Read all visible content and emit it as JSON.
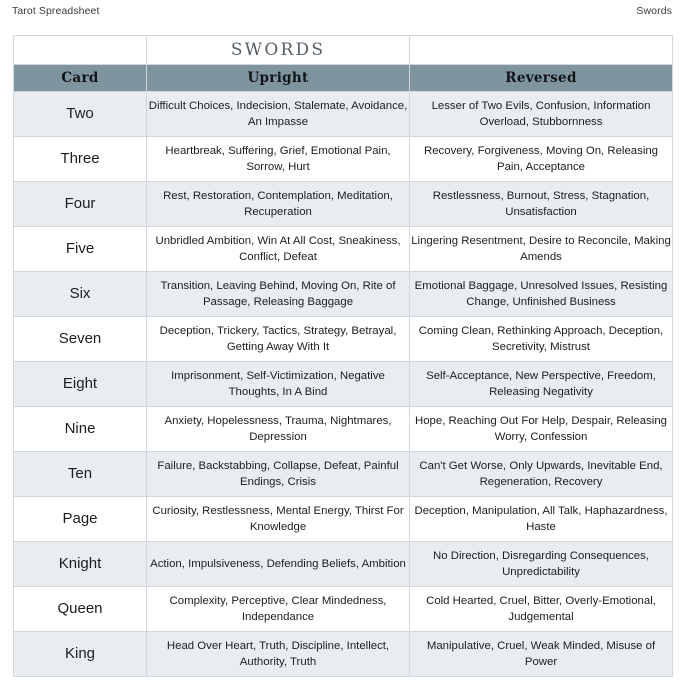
{
  "doc_header": {
    "left": "Tarot Spreadsheet",
    "right": "Swords"
  },
  "table": {
    "suit_title": "SWORDS",
    "columns": {
      "card": "Card",
      "upright": "Upright",
      "reversed": "Reversed"
    },
    "colors": {
      "header_band": "#7e959f",
      "row_alt": "#e9edf1",
      "row_plain": "#ffffff",
      "border": "#d2d7db",
      "text": "#1d1d1d"
    },
    "rows": [
      {
        "card": "Two",
        "upright": "Difficult Choices, Indecision, Stalemate, Avoidance, An Impasse",
        "reversed": "Lesser of Two Evils, Confusion, Information Overload, Stubbornness"
      },
      {
        "card": "Three",
        "upright": "Heartbreak, Suffering, Grief, Emotional Pain, Sorrow, Hurt",
        "reversed": "Recovery, Forgiveness, Moving On, Releasing Pain, Acceptance"
      },
      {
        "card": "Four",
        "upright": "Rest, Restoration, Contemplation, Meditation, Recuperation",
        "reversed": "Restlessness, Burnout, Stress, Stagnation, Unsatisfaction"
      },
      {
        "card": "Five",
        "upright": "Unbridled Ambition, Win At All Cost, Sneakiness, Conflict, Defeat",
        "reversed": "Lingering Resentment, Desire to Reconcile, Making Amends"
      },
      {
        "card": "Six",
        "upright": "Transition, Leaving Behind, Moving On, Rite of Passage, Releasing Baggage",
        "reversed": "Emotional Baggage, Unresolved Issues, Resisting Change, Unfinished Business"
      },
      {
        "card": "Seven",
        "upright": "Deception, Trickery, Tactics, Strategy, Betrayal, Getting Away With It",
        "reversed": "Coming Clean, Rethinking Approach, Deception, Secretivity, Mistrust"
      },
      {
        "card": "Eight",
        "upright": "Imprisonment, Self-Victimization, Negative Thoughts, In A Bind",
        "reversed": "Self-Acceptance, New Perspective, Freedom, Releasing Negativity"
      },
      {
        "card": "Nine",
        "upright": "Anxiety, Hopelessness, Trauma, Nightmares, Depression",
        "reversed": "Hope, Reaching Out For Help, Despair, Releasing Worry, Confession"
      },
      {
        "card": "Ten",
        "upright": "Failure, Backstabbing, Collapse, Defeat, Painful Endings, Crisis",
        "reversed": "Can't Get Worse, Only Upwards, Inevitable End, Regeneration, Recovery"
      },
      {
        "card": "Page",
        "upright": "Curiosity, Restlessness, Mental Energy, Thirst For Knowledge",
        "reversed": "Deception, Manipulation, All Talk, Haphazardness, Haste"
      },
      {
        "card": "Knight",
        "upright": "Action, Impulsiveness, Defending Beliefs, Ambition",
        "reversed": "No Direction, Disregarding Consequences, Unpredictability"
      },
      {
        "card": "Queen",
        "upright": "Complexity, Perceptive, Clear Mindedness, Independance",
        "reversed": "Cold Hearted, Cruel, Bitter, Overly-Emotional, Judgemental"
      },
      {
        "card": "King",
        "upright": "Head Over Heart, Truth, Discipline, Intellect, Authority, Truth",
        "reversed": "Manipulative, Cruel, Weak Minded, Misuse of Power"
      }
    ]
  }
}
